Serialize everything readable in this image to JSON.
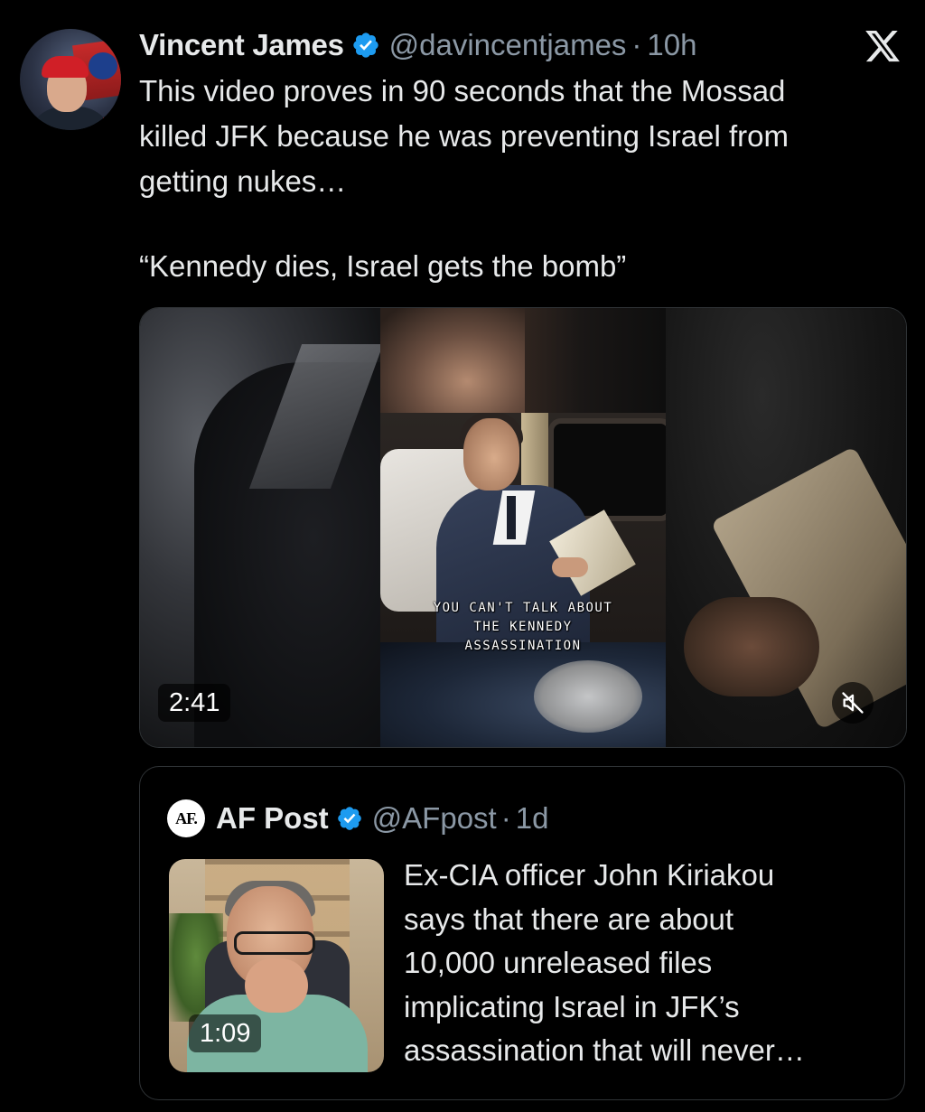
{
  "tweet": {
    "author_name": "Vincent James",
    "handle": "@davincentjames",
    "separator": "·",
    "time": "10h",
    "avatar_tag": "STA",
    "text_lines": [
      "This video proves in 90 seconds that the Mossad",
      "killed JFK because he was preventing Israel from",
      "getting nukes…"
    ],
    "quote_line": "“Kennedy dies, Israel gets the bomb”",
    "video": {
      "caption_lines": [
        "YOU CAN'T TALK ABOUT",
        "THE KENNEDY",
        "ASSASSINATION"
      ],
      "duration": "2:41",
      "mute_icon": "muted-speaker-icon"
    }
  },
  "quoted_tweet": {
    "avatar_text": "AF.",
    "author_name": "AF Post",
    "handle": "@AFpost",
    "separator": "·",
    "time": "1d",
    "duration": "1:09",
    "text_lines": [
      "Ex-CIA officer John Kiriakou",
      "says that there are about",
      "10,000 unreleased files",
      "implicating Israel in JFK’s",
      "assassination that will never…"
    ]
  },
  "icons": {
    "verified": "verified-badge-icon",
    "platform_logo": "x-logo-icon"
  },
  "colors": {
    "background": "#000000",
    "text_primary": "#e7e9ea",
    "text_secondary": "#8b98a5",
    "verified_blue": "#1d9bf0",
    "border": "#2f3336"
  }
}
